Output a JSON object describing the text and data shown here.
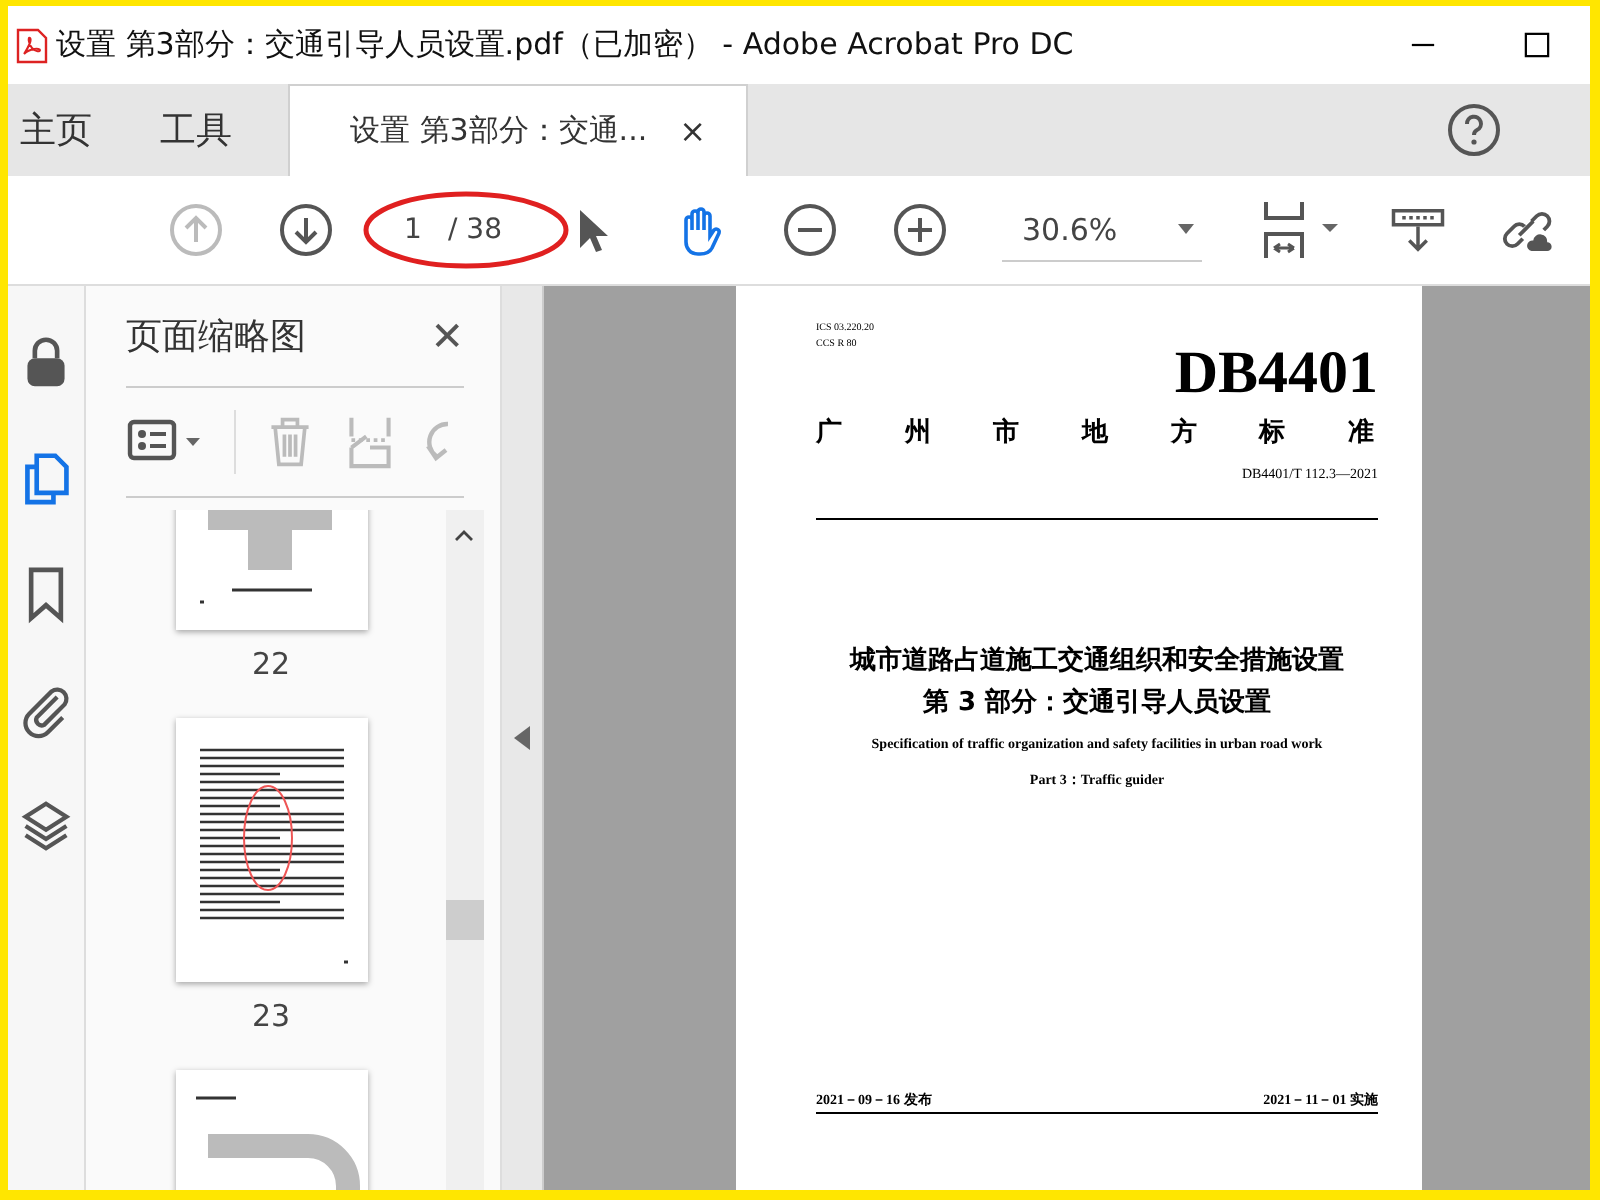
{
  "window": {
    "title": "设置 第3部分：交通引导人员设置.pdf（已加密） - Adobe Acrobat Pro DC"
  },
  "tabs": [
    {
      "label": "主页",
      "selected": false
    },
    {
      "label": "工具",
      "selected": false
    },
    {
      "label": "设置 第3部分：交通...",
      "selected": true,
      "close": "×"
    }
  ],
  "toolbar": {
    "page_input": "1",
    "page_total": "/ 38",
    "zoom": "30.6%"
  },
  "rail": [
    {
      "kind": "lock",
      "selected": false
    },
    {
      "kind": "pages",
      "selected": true
    },
    {
      "kind": "bookmark",
      "selected": false
    },
    {
      "kind": "attachment",
      "selected": false
    },
    {
      "kind": "layers",
      "selected": false
    }
  ],
  "panel": {
    "title": "页面缩略图",
    "close": "✕",
    "thumbnails": [
      {
        "page": "22",
        "kind": "crossroad"
      },
      {
        "page": "23",
        "kind": "text"
      },
      {
        "kind": "curve"
      }
    ]
  },
  "document": {
    "ics": "ICS 03.220.20",
    "ccs": "CCS R 80",
    "code": "DB4401",
    "authority": "广州市地方标准",
    "number": "DB4401/T 112.3—2021",
    "title_lines": [
      "城市道路占道施工交通组织和安全措施设置",
      "第 3 部分：交通引导人员设置"
    ],
    "english": [
      "Specification of traffic organization and safety facilities in urban road work",
      "Part 3：Traffic guider"
    ],
    "issued": "2021－09－16 发布",
    "effective": "2021－11－01 实施"
  }
}
